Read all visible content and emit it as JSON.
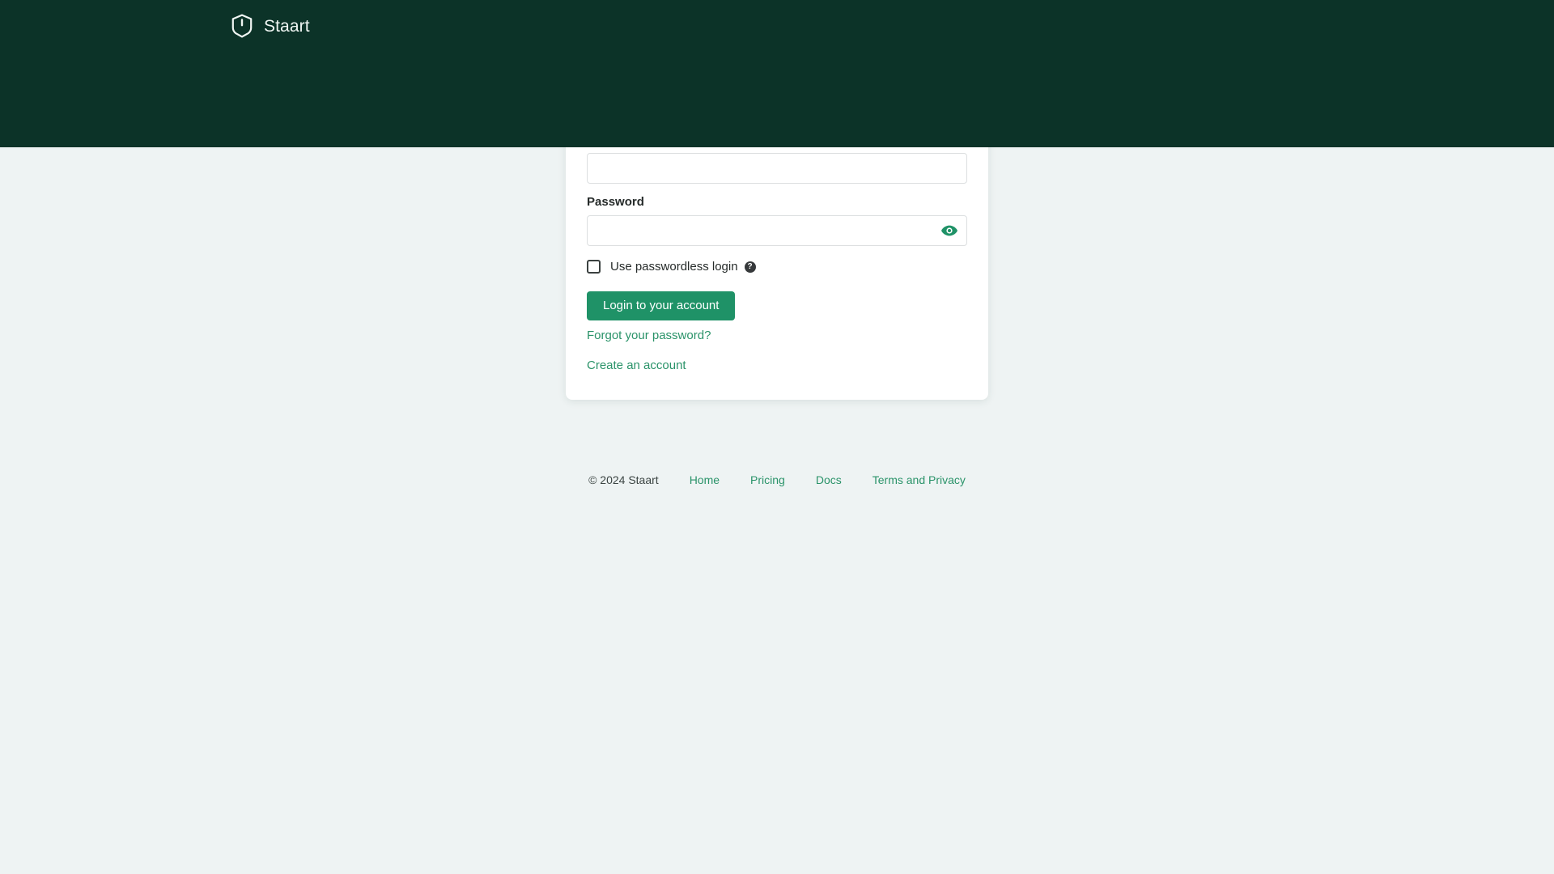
{
  "header": {
    "brand_name": "Staart",
    "logo_icon": "shield-power-icon",
    "background_color": "#0c3328"
  },
  "page": {
    "background_color": "#eef3f3"
  },
  "login_card": {
    "email_field": {
      "value": "",
      "placeholder": ""
    },
    "password_field": {
      "label": "Password",
      "value": "",
      "placeholder": "",
      "reveal_icon": "eye-icon"
    },
    "passwordless": {
      "label": "Use passwordless login",
      "checked": false,
      "help_icon": "question-mark-icon",
      "help_icon_glyph": "?"
    },
    "submit_label": "Login to your account",
    "forgot_password_label": "Forgot your password?",
    "create_account_label": "Create an account",
    "accent_color": "#1f9267",
    "link_color": "#2a9369"
  },
  "footer": {
    "copyright": "© 2024 Staart",
    "links": [
      {
        "label": "Home"
      },
      {
        "label": "Pricing"
      },
      {
        "label": "Docs"
      },
      {
        "label": "Terms and Privacy"
      }
    ]
  }
}
